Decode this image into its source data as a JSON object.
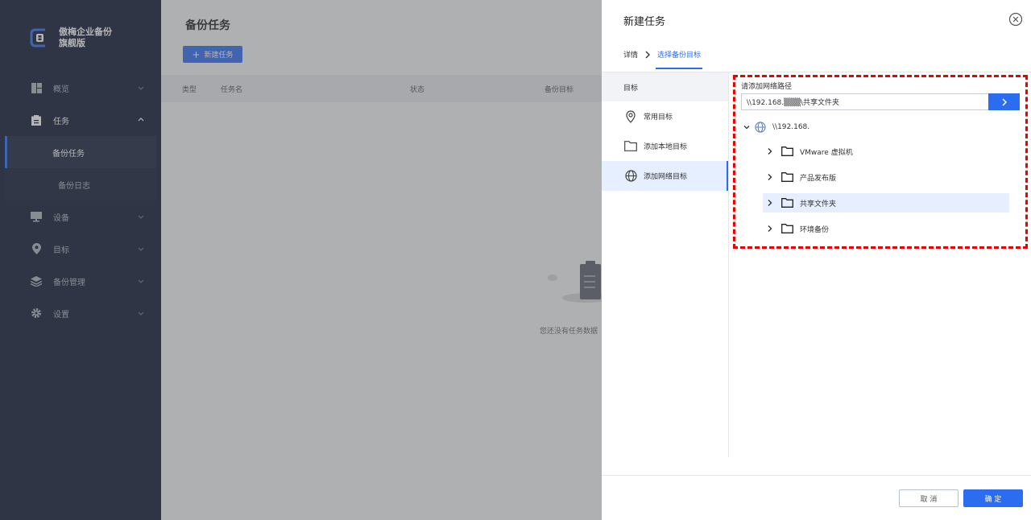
{
  "brand": {
    "line1": "傲梅企业备份",
    "line2": "旗舰版"
  },
  "nav": {
    "overview": "概览",
    "tasks": "任务",
    "backup_tasks": "备份任务",
    "backup_log": "备份日志",
    "devices": "设备",
    "targets": "目标",
    "backup_mgmt": "备份管理",
    "settings": "设置"
  },
  "main": {
    "title": "备份任务",
    "new_task": "新建任务",
    "columns": [
      "类型",
      "任务名",
      "状态",
      "备份目标"
    ],
    "empty_text": "您还没有任务数据"
  },
  "drawer": {
    "title": "新建任务",
    "crumb_details": "详情",
    "crumb_target": "选择备份目标",
    "left_header": "目标",
    "left_items": [
      "常用目标",
      "添加本地目标",
      "添加网络目标"
    ],
    "path_label": "请添加网络路径",
    "path_value": "\\\\192.168.▒▒▒\\共享文件夹",
    "tree_root": "\\\\192.168.",
    "tree_items": [
      "VMware 虚拟机",
      "产品发布版",
      "共享文件夹",
      "环境备份"
    ],
    "cancel": "取 消",
    "ok": "确 定"
  },
  "colors": {
    "accent": "#2b6cf0",
    "sidebar": "#0c1633",
    "highlight": "#e00000"
  }
}
